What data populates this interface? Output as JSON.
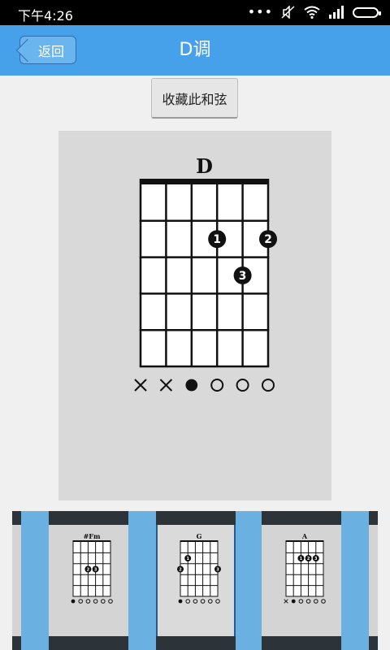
{
  "status_bar": {
    "time": "下午4:26",
    "battery_icon": "battery-icon",
    "signal_icon": "signal-icon",
    "wifi_icon": "wifi-icon"
  },
  "header": {
    "back_label": "返回",
    "title": "D调",
    "color": "#47a1ea"
  },
  "favorite_button": {
    "label": "收藏此和弦"
  },
  "chord": {
    "name": "D",
    "strings": 6,
    "frets": 5,
    "string_marks": [
      "x",
      "x",
      "open-filled",
      "o",
      "o",
      "o"
    ],
    "fingers": [
      {
        "finger": "1",
        "string": 4,
        "fret": 2
      },
      {
        "finger": "2",
        "string": 6,
        "fret": 2
      },
      {
        "finger": "3",
        "string": 5,
        "fret": 3
      }
    ]
  },
  "thumbnails": [
    {
      "name": "#Fm",
      "selected": false,
      "marks": [
        "filled",
        "o",
        "o",
        "o",
        "o",
        "o"
      ],
      "fingers": [
        {
          "finger": "2",
          "string": 3,
          "fret": 3
        },
        {
          "finger": "3",
          "string": 4,
          "fret": 3
        }
      ]
    },
    {
      "name": "G",
      "selected": true,
      "marks": [
        "filled",
        "o",
        "o",
        "o",
        "o",
        "o"
      ],
      "fingers": [
        {
          "finger": "1",
          "string": 2,
          "fret": 2
        },
        {
          "finger": "2",
          "string": 1,
          "fret": 3
        },
        {
          "finger": "3",
          "string": 6,
          "fret": 3
        }
      ]
    },
    {
      "name": "A",
      "selected": false,
      "marks": [
        "x",
        "filled",
        "o",
        "o",
        "o",
        "o"
      ],
      "fingers": [
        {
          "finger": "1",
          "string": 3,
          "fret": 2
        },
        {
          "finger": "2",
          "string": 4,
          "fret": 2
        },
        {
          "finger": "3",
          "string": 5,
          "fret": 2
        }
      ]
    }
  ]
}
